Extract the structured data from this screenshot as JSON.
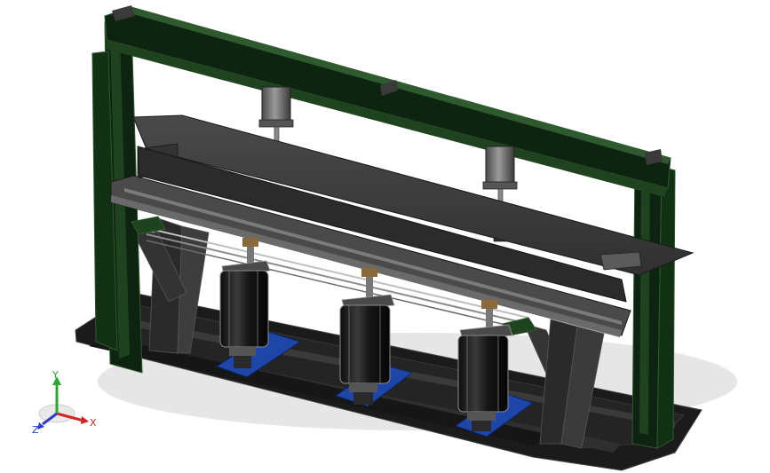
{
  "model": {
    "colors": {
      "frame": "#0d2410",
      "frame_edge": "#2f5a2f",
      "frame_light": "#1e3e1e",
      "plate": "#3b3b3c",
      "plate_dark": "#262627",
      "plate_light": "#555557",
      "base": "#1c1c1c",
      "base_light": "#2e2e2f",
      "cylinder": "#1a1a1a",
      "cylinder_edge": "#8a8a8a",
      "pad": "#1d46a8",
      "shadow": "#d7d7d7"
    },
    "upper_cylinders": 2,
    "lower_cylinders": 3
  },
  "triad": {
    "x_label": "X",
    "y_label": "Y",
    "z_label": "Z",
    "x_color": "#d42424",
    "y_color": "#2aa82a",
    "z_color": "#2c3ec8"
  }
}
